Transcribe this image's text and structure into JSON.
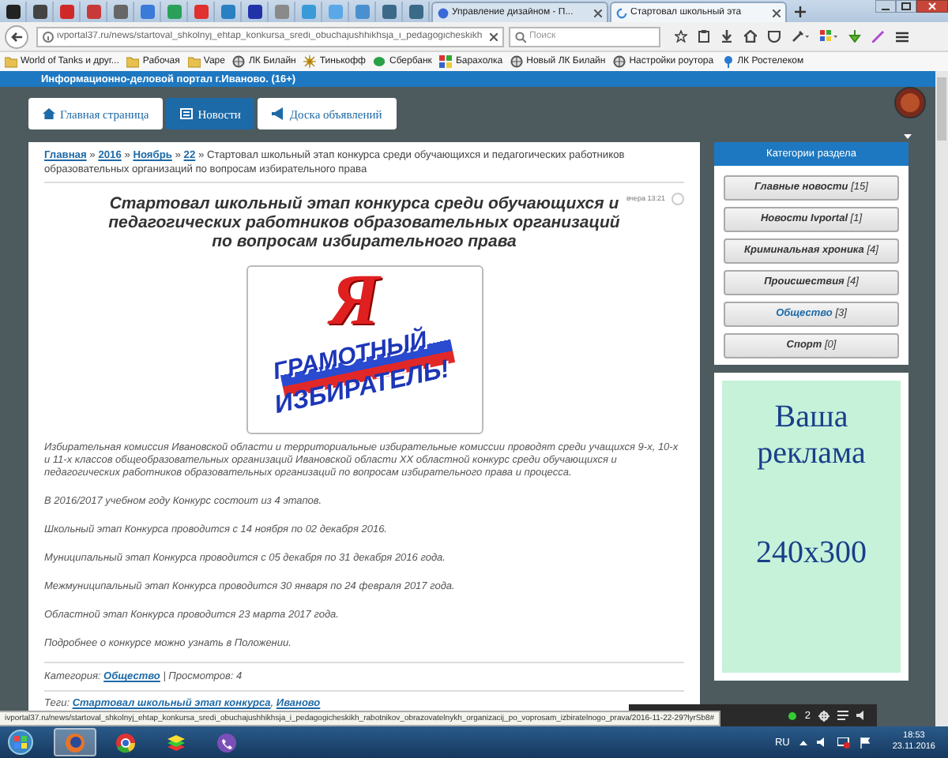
{
  "browser": {
    "pinned_tabs": [
      {
        "color": "#222222"
      },
      {
        "color": "#444444"
      },
      {
        "color": "#d02828"
      },
      {
        "color": "#c83a3a"
      },
      {
        "color": "#666666"
      },
      {
        "color": "#3a7ad8"
      },
      {
        "color": "#2aa05a"
      },
      {
        "color": "#e03030"
      },
      {
        "color": "#2a80c0"
      },
      {
        "color": "#2233aa"
      },
      {
        "color": "#8a8a8a"
      },
      {
        "color": "#3a9ad8"
      },
      {
        "color": "#5aa8e8"
      },
      {
        "color": "#4a90d0"
      },
      {
        "color": "#3a6a88"
      },
      {
        "color": "#3a6a88"
      }
    ],
    "tabs": [
      {
        "label": "Управление дизайном - П...",
        "selected": false
      },
      {
        "label": "Стартовал школьный эта",
        "selected": true
      }
    ],
    "address": {
      "value": "ivportal37.ru/news/startoval_shkolnyj_ehtap_konkursa_sredi_obuchajushhikhsja_i_pedagogicheskikh"
    },
    "search": {
      "placeholder": "Поиск"
    },
    "bookmarks": [
      {
        "label": "World of Tanks и друг...",
        "kind": "folder"
      },
      {
        "label": "Рабочая",
        "kind": "folder"
      },
      {
        "label": "Vape",
        "kind": "folder"
      },
      {
        "label": "ЛК Билайн",
        "kind": "globe"
      },
      {
        "label": "Тинькофф",
        "kind": "sun"
      },
      {
        "label": "Сбербанк",
        "kind": "leaf"
      },
      {
        "label": "Барахолка",
        "kind": "grid"
      },
      {
        "label": "Новый ЛК Билайн",
        "kind": "globe"
      },
      {
        "label": "Настройки роутора",
        "kind": "globe"
      },
      {
        "label": "ЛК Ростелеком",
        "kind": "pin"
      }
    ]
  },
  "site": {
    "header_text": "Информационно-деловой портал г.Иваново. (16+)",
    "nav": [
      {
        "label": "Главная страница",
        "kind": "home",
        "selected": false
      },
      {
        "label": "Новости",
        "kind": "news",
        "selected": true
      },
      {
        "label": "Доска объявлений",
        "kind": "megaphone",
        "selected": false
      }
    ]
  },
  "breadcrumb": {
    "separator": "»",
    "links": [
      "Главная",
      "2016",
      "Ноябрь",
      "22"
    ],
    "current": "Стартовал школьный этап конкурса среди обучающихся и педагогических работников образовательных организаций по вопросам избирательного права"
  },
  "article": {
    "title": "Стартовал школьный этап конкурса среди обучающихся и педагогических работников образовательных организаций по вопросам избирательного права",
    "date": "вчера 13:21",
    "image": {
      "letter": "Я",
      "line_1": "ГРАМОТНЫЙ",
      "line_2": "ИЗБИРАТЕЛЬ!"
    },
    "paragraphs": [
      "Избирательная комиссия Ивановской области и территориальные избирательные комиссии проводят среди учащихся 9-х, 10-х и 11-х классов общеобразовательных организаций Ивановской области XX областной конкурс среди обучающихся и педагогических работников образовательных организаций по вопросам избирательного права и процесса.",
      "В 2016/2017 учебном году Конкурс состоит из 4 этапов.",
      "Школьный этап Конкурса проводится с 14 ноября по 02 декабря 2016.",
      "Муниципальный этап Конкурса проводится с 05 декабря по 31 декабря 2016 года.",
      "Межмуниципальный этап Конкурса проводится 30 января по 24 февраля 2017 года.",
      "Областной этап Конкурса проводится 23 марта 2017 года.",
      "Подробнее о конкурсе можно узнать в Положении."
    ],
    "category_label": "Категория:",
    "category": "Общество",
    "views": "| Просмотров: 4",
    "tags_label": "Теги:",
    "tag_separator": ",",
    "tags": [
      "Стартовал школьный этап конкурса",
      "Иваново"
    ]
  },
  "sidebar": {
    "title": "Категории раздела",
    "categories": [
      {
        "label": "Главные новости",
        "count": "[15]",
        "selected": false
      },
      {
        "label": "Новости Ivportal",
        "count": "[1]",
        "selected": false
      },
      {
        "label": "Криминальная хроника",
        "count": "[4]",
        "selected": false
      },
      {
        "label": "Происшествия",
        "count": "[4]",
        "selected": false
      },
      {
        "label": "Общество",
        "count": "[3]",
        "selected": true
      },
      {
        "label": "Спорт",
        "count": "[0]",
        "selected": false
      }
    ],
    "ad": [
      "Ваша",
      "реклама",
      "240x300"
    ]
  },
  "status_url": "ivportal37.ru/news/startoval_shkolnyj_ehtap_konkursa_sredi_obuchajushhikhsja_i_pedagogicheskikh_rabotnikov_obrazovatelnykh_organizacij_po_voprosam_izbiratelnogo_prava/2016-11-22-29?lyrSb8#",
  "media_bar": {
    "count": "2"
  },
  "taskbar": {
    "apps": [
      {
        "kind": "firefox",
        "selected": true
      },
      {
        "kind": "chrome",
        "selected": false
      },
      {
        "kind": "stack",
        "selected": false
      },
      {
        "kind": "phone",
        "selected": false
      }
    ],
    "language": "RU",
    "time": "18:53",
    "date": "23.11.2016"
  }
}
